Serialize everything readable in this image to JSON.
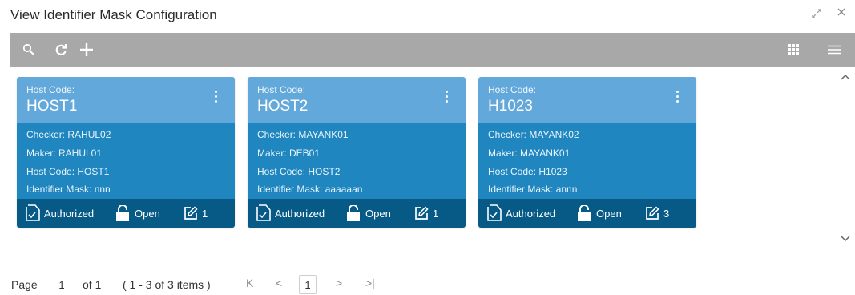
{
  "window": {
    "title": "View Identifier Mask Configuration"
  },
  "icons": {
    "search": "search-icon",
    "refresh": "refresh-icon",
    "add": "plus-icon",
    "grid": "grid-view-icon",
    "list": "list-view-icon",
    "resize": "collapse-icon",
    "close": "close-icon"
  },
  "colors": {
    "toolbar": "#a8a8a8",
    "card_head": "#63a8da",
    "card_body": "#1f86bf",
    "card_foot": "#065a85"
  },
  "cards": [
    {
      "host_code_label": "Host Code:",
      "host_code": "HOST1",
      "checker": "Checker: RAHUL02",
      "maker": "Maker: RAHUL01",
      "host_code_row": "Host Code: HOST1",
      "identifier_mask": "Identifier Mask: nnn",
      "status": "Authorized",
      "lock": "Open",
      "version": "1"
    },
    {
      "host_code_label": "Host Code:",
      "host_code": "HOST2",
      "checker": "Checker: MAYANK01",
      "maker": "Maker: DEB01",
      "host_code_row": "Host Code: HOST2",
      "identifier_mask": "Identifier Mask: aaaaaan",
      "status": "Authorized",
      "lock": "Open",
      "version": "1"
    },
    {
      "host_code_label": "Host Code:",
      "host_code": "H1023",
      "checker": "Checker: MAYANK02",
      "maker": "Maker: MAYANK01",
      "host_code_row": "Host Code: H1023",
      "identifier_mask": "Identifier Mask: annn",
      "status": "Authorized",
      "lock": "Open",
      "version": "3"
    }
  ],
  "pagination": {
    "page_label": "Page",
    "current_page": "1",
    "of_label": "of 1",
    "items_summary": "( 1 - 3 of 3 items )",
    "page_button": "1",
    "first": "K",
    "prev": "<",
    "next": ">",
    "last": ">|"
  }
}
